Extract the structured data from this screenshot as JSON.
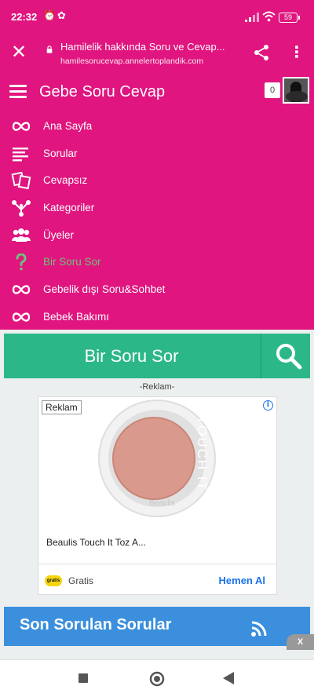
{
  "status": {
    "time": "22:32",
    "battery": "59"
  },
  "browser": {
    "page_title": "Hamilelik hakkında Soru ve Cevap...",
    "url": "hamilesorucevap.annelertoplandik.com"
  },
  "site": {
    "brand": "Gebe Soru Cevap",
    "notification_count": "0",
    "menu": [
      {
        "label": "Ana Sayfa",
        "icon": "infinity-icon"
      },
      {
        "label": "Sorular",
        "icon": "lines-icon"
      },
      {
        "label": "Cevapsız",
        "icon": "cards-icon"
      },
      {
        "label": "Kategoriler",
        "icon": "hierarchy-icon"
      },
      {
        "label": "Üyeler",
        "icon": "users-icon"
      },
      {
        "label": "Bir Soru Sor",
        "icon": "question-icon",
        "active": true
      },
      {
        "label": "Gebelik dışı Soru&Sohbet",
        "icon": "infinity-icon"
      },
      {
        "label": "Bebek Bakımı",
        "icon": "infinity-icon"
      }
    ]
  },
  "ask": {
    "label": "Bir Soru Sor"
  },
  "ad": {
    "section_label": "-Reklam-",
    "tag": "Reklam",
    "product_brand": "Beaulis",
    "product_name": "TOUCH IT",
    "title": "Beaulis Touch It Toz A...",
    "store_logo": "gratis",
    "store": "Gratis",
    "cta": "Hemen Al",
    "close": "X"
  },
  "recent": {
    "title": "Son Sorulan Sorular"
  },
  "colors": {
    "primary": "#e0157f",
    "green": "#2cb789",
    "blue": "#3b8fdd"
  }
}
